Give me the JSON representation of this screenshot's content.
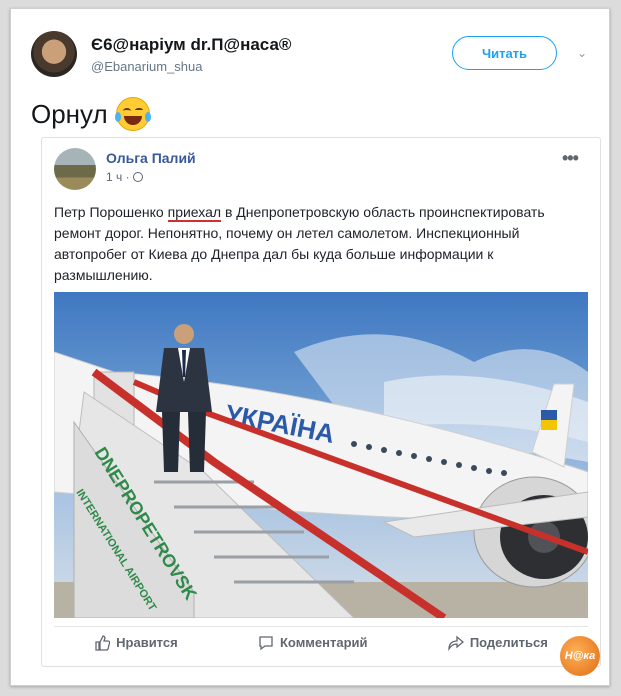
{
  "tweet": {
    "author_name": "Є6@наріум dr.П@наса®",
    "author_handle": "@Ebanarium_shua",
    "follow_label": "Читать",
    "text": "Орнул",
    "emoji_icon": "tears-of-joy-icon"
  },
  "fb_post": {
    "author": "Ольга Палий",
    "time": "1 ч ·",
    "text_before": "Петр Порошенко ",
    "text_underlined": "приехал",
    "text_after": " в Днепропетровскую область проинспектировать ремонт дорог. Непонятно, почему он летел самолетом. Инспекционный автопробег от Киева до Днепра дал бы куда больше информации к размышлению.",
    "photo_plane_text": "УКРАЇНА",
    "photo_stair_text": "DNEPROPETROVSK",
    "photo_stair_text2": "INTERNATIONAL AIRPORT",
    "actions": {
      "like": "Нравится",
      "comment": "Комментарий",
      "share": "Поделиться"
    }
  },
  "watermark": "Н@ка",
  "colors": {
    "twitter_blue": "#1da1f2",
    "fb_link": "#385898",
    "underline_red": "#d23030"
  }
}
